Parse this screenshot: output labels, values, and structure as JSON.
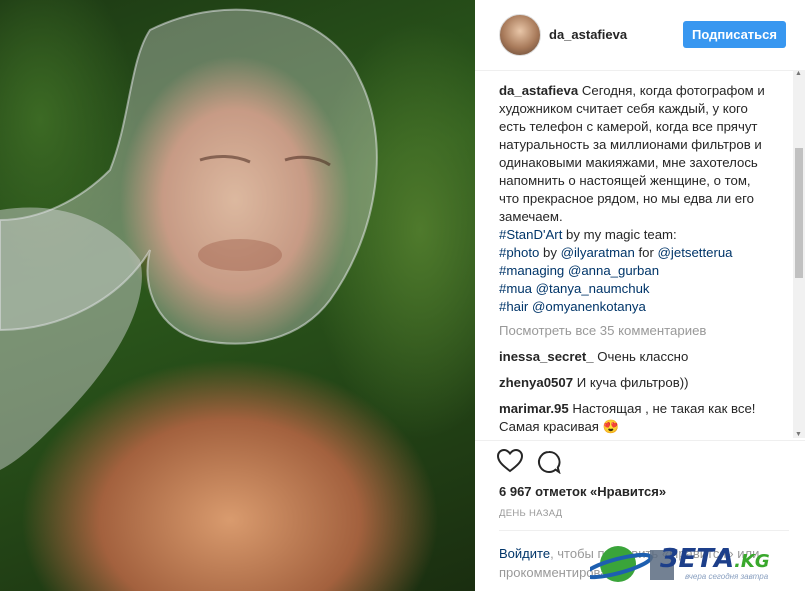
{
  "post": {
    "username": "da_astafieva",
    "follow_label": "Подписаться",
    "caption_user": "da_astafieva",
    "caption_text": "Сегодня, когда фотографом и художником считает себя каждый, у кого есть телефон с камерой, когда все прячут натуральность за миллионами фильтров и одинаковыми макияжами, мне захотелось напомнить о настоящей женщине, о том, что прекрасное рядом, но мы едва ли его замечаем.",
    "line1_tag": "#StanD'Art",
    "line1_text": " by my magic team:",
    "line2_tag": "#photo",
    "line2_mid": " by ",
    "line2_user": "@ilyaratman",
    "line2_for": " for ",
    "line2_user2": "@jetsetterua",
    "line3_tag": "#managing",
    "line3_user": "@anna_gurban",
    "line4_tag": "#mua",
    "line4_user": "@tanya_naumchuk",
    "line5_tag": "#hair",
    "line5_user": "@omyanenkotanya",
    "view_all": "Посмотреть все 35 комментариев"
  },
  "comments": [
    {
      "user": "inessa_secret_",
      "text": "Очень классно"
    },
    {
      "user": "zhenya0507",
      "text": "И куча фильтров))"
    },
    {
      "user": "marimar.95",
      "text": "Настоящая , не такая как все! Самая красивая 😍"
    }
  ],
  "likes_text": "6 967 отметок «Нравится»",
  "time_text": "ДЕНЬ НАЗАД",
  "login": {
    "link_text": "Войдите",
    "rest": ", чтобы поставить «Нравится» или прокомментировать."
  },
  "watermark": {
    "brand": "ЗЕТА",
    "suffix": ".KG",
    "tagline": "вчера сегодня завтра"
  },
  "icons": [
    "heart-icon",
    "comment-icon",
    "scroll-up-icon",
    "scroll-down-icon"
  ],
  "colors": {
    "follow_button": "#3897f0",
    "link": "#003569",
    "muted": "#999999"
  }
}
